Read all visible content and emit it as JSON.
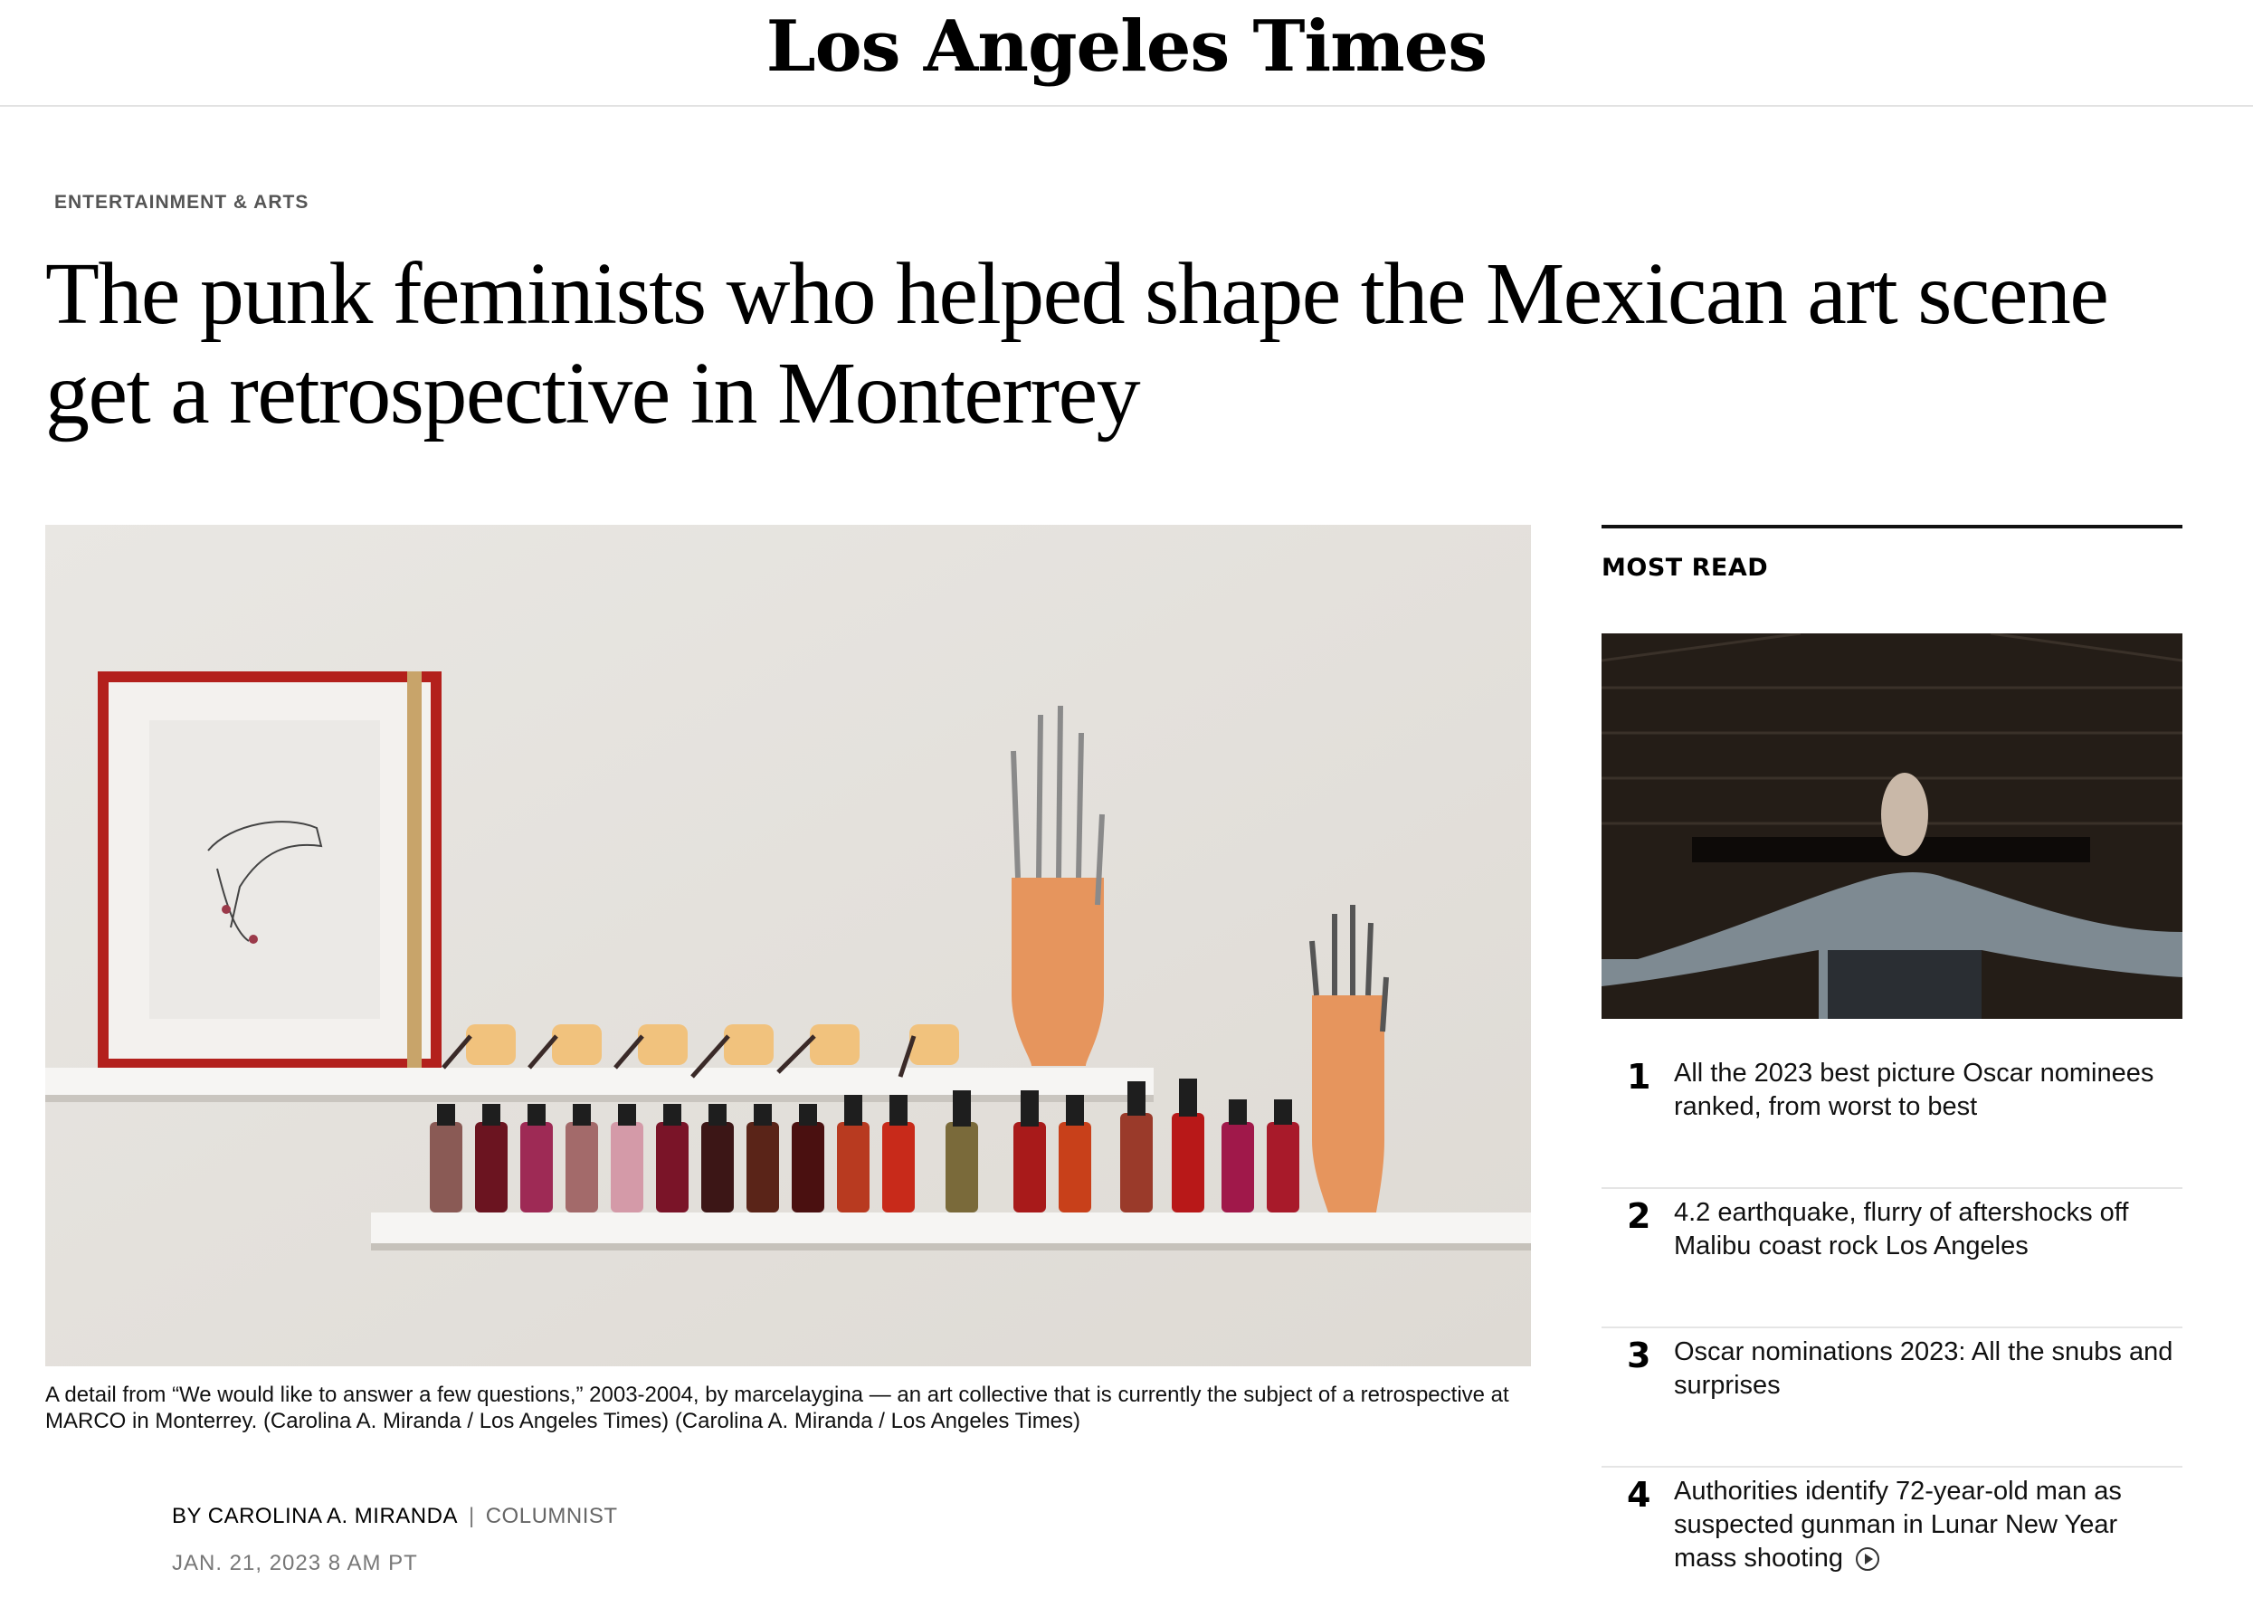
{
  "masthead": {
    "logo_text": "Los Angeles Times"
  },
  "article": {
    "section": "ENTERTAINMENT & ARTS",
    "headline": "The punk feminists who helped shape the Mexican art scene get a retrospective in Monterrey",
    "caption": "A detail from “We would like to answer a few questions,” 2003-2004, by marcelaygina — an art collective that is currently the subject of a retrospective at MARCO in Monterrey. (Carolina A. Miranda / Los Angeles Times) (Carolina A. Miranda / Los Angeles Times)",
    "byline": "BY CAROLINA A. MIRANDA",
    "byline_separator": "|",
    "role": "COLUMNIST",
    "date": "JAN. 21, 2023 8 AM PT"
  },
  "most_read": {
    "title": "MOST READ",
    "items": [
      {
        "rank": "1",
        "text": "All the 2023 best picture Oscar nominees ranked, from worst to best"
      },
      {
        "rank": "2",
        "text": "4.2 earthquake, flurry of aftershocks off Malibu coast rock Los Angeles"
      },
      {
        "rank": "3",
        "text": "Oscar nominations 2023: All the snubs and surprises"
      },
      {
        "rank": "4",
        "text": "Authorities identify 72-year-old man as suspected gunman in Lunar New Year mass shooting",
        "icon": "play-icon"
      }
    ]
  },
  "colors": {
    "frame_red": "#b3201c",
    "nail_red": "#9e1a1d",
    "shelf_white": "#f6f5f3"
  }
}
